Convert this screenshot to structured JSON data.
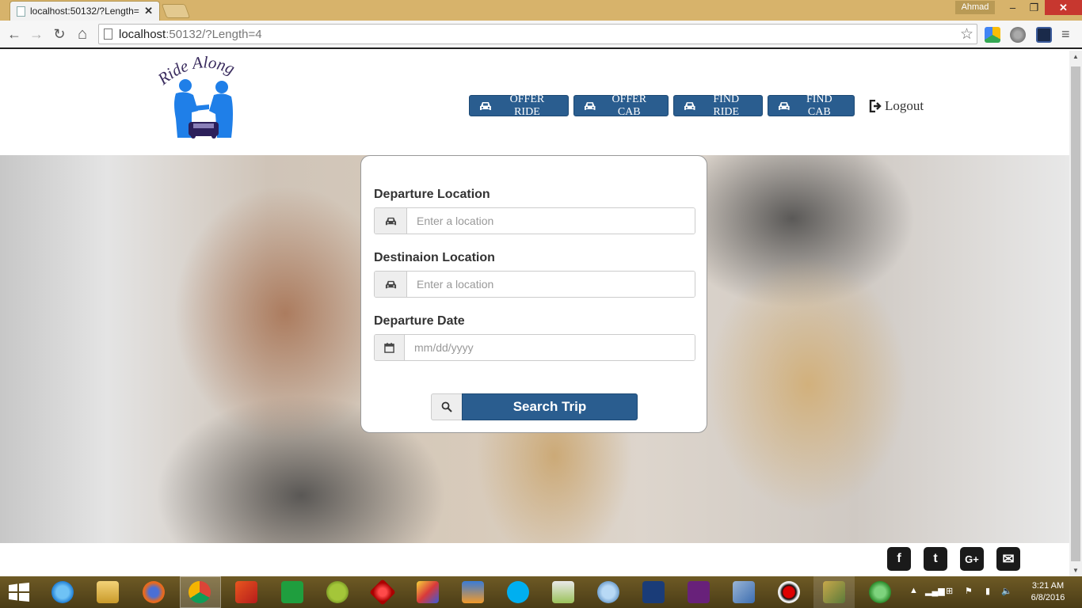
{
  "browser": {
    "tab_title": "localhost:50132/?Length=",
    "tab_close": "✕",
    "user_name": "Ahmad",
    "url_host": "localhost",
    "url_rest": ":50132/?Length=4",
    "back_icon": "←",
    "forward_icon": "→",
    "reload_icon": "↻",
    "home_icon": "⌂",
    "star_icon": "☆",
    "menu_icon": "≡",
    "minimize_icon": "–",
    "maximize_icon": "❐",
    "close_icon": "✕"
  },
  "header": {
    "logo_text": "Ride Along",
    "nav": [
      {
        "label": "OFFER RIDE"
      },
      {
        "label": "OFFER CAB"
      },
      {
        "label": "FIND RIDE"
      },
      {
        "label": "FIND CAB"
      }
    ],
    "logout_label": "Logout"
  },
  "search_form": {
    "departure_label": "Departure Location",
    "departure_placeholder": "Enter a location",
    "destination_label": "Destinaion Location",
    "destination_placeholder": "Enter a location",
    "date_label": "Departure Date",
    "date_placeholder": "mm/dd/yyyy",
    "submit_label": "Search Trip"
  },
  "footer": {
    "social": [
      {
        "name": "facebook",
        "glyph": "f"
      },
      {
        "name": "twitter",
        "glyph": "t"
      },
      {
        "name": "google-plus",
        "glyph": "G+"
      },
      {
        "name": "email",
        "glyph": "✉"
      }
    ]
  },
  "taskbar": {
    "time": "3:21 AM",
    "date": "6/8/2016"
  },
  "colors": {
    "button_blue": "#2a5d8f",
    "chrome_frame": "#d7b36b"
  }
}
